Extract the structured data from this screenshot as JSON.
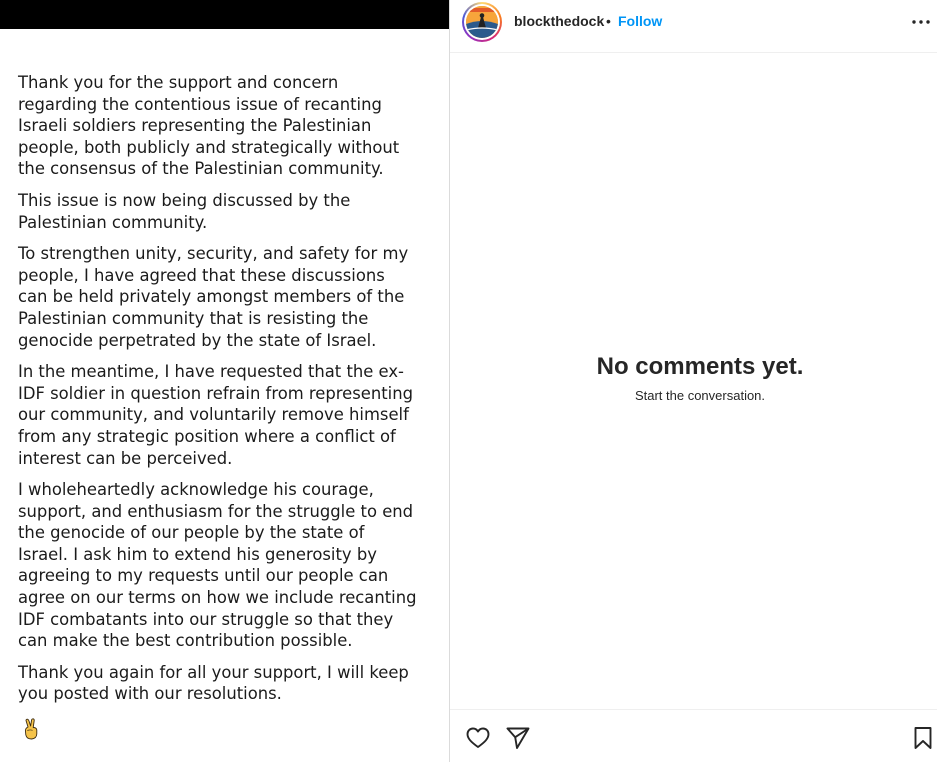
{
  "post": {
    "paragraphs": [
      "Thank you for the support and concern regarding the contentious issue of recanting Israeli soldiers representing the Palestinian people, both publicly and strategically without the consensus of the Palestinian community.",
      "This issue is now being discussed by the Palestinian community.",
      "To strengthen unity, security, and safety for my people, I have agreed that these discussions can be held privately amongst members of the Palestinian community that is resisting the genocide perpetrated by the state of Israel.",
      "In the meantime, I have requested that the ex-IDF soldier in question refrain from representing our community, and voluntarily remove himself from any strategic position where a conflict of interest can be perceived.",
      "I wholeheartedly acknowledge his courage, support, and enthusiasm for the struggle to end the genocide of our people by the state of Israel. I ask him to extend his generosity by agreeing to my requests until our people can agree on our terms on how we include recanting IDF combatants into our struggle so that they can make the best contribution possible.",
      "Thank you again for all your support, I will keep you posted with our resolutions."
    ],
    "emoji": "victory-hand-icon"
  },
  "header": {
    "username": "blockthedock",
    "separator": "•",
    "follow_label": "Follow"
  },
  "comments": {
    "empty_title": "No comments yet.",
    "empty_subtitle": "Start the conversation."
  },
  "colors": {
    "link": "#0095f6",
    "text": "#262626",
    "border": "#dbdbdb"
  }
}
